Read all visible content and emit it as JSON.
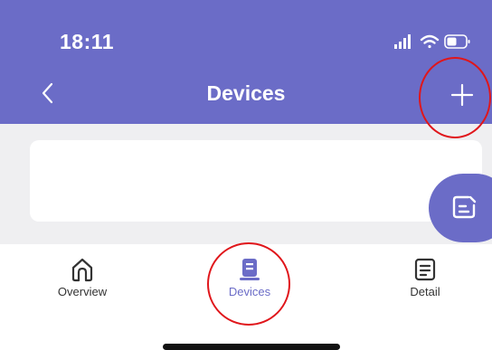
{
  "status_bar": {
    "time": "18:11"
  },
  "nav": {
    "title": "Devices",
    "back_icon": "chevron-left-icon",
    "add_icon": "plus-icon"
  },
  "fab": {
    "icon": "edit-note-icon"
  },
  "tabs": [
    {
      "label": "Overview",
      "icon": "home-icon",
      "active": false
    },
    {
      "label": "Devices",
      "icon": "device-icon",
      "active": true
    },
    {
      "label": "Detail",
      "icon": "list-document-icon",
      "active": false
    }
  ],
  "colors": {
    "primary": "#6b6cc7",
    "background": "#efeff1",
    "annotation": "#e0161b"
  }
}
